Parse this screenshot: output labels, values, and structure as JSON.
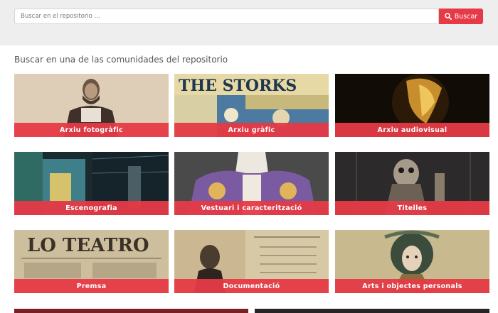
{
  "search": {
    "placeholder": "Buscar en el repositorio ...",
    "value": "",
    "button_label": "Buscar",
    "button_icon": "search-icon"
  },
  "section": {
    "heading": "Buscar en una de las comunidades del repositorio"
  },
  "communities": [
    {
      "label": "Arxiu fotogràfic",
      "image": "portrait-photograph"
    },
    {
      "label": "Arxiu gràfic",
      "image": "the-storks-poster"
    },
    {
      "label": "Arxiu audiovisual",
      "image": "golden-mask-in-dark"
    },
    {
      "label": "Escenografia",
      "image": "stage-set-model"
    },
    {
      "label": "Vestuari i caracterització",
      "image": "embroidered-costume"
    },
    {
      "label": "Titelles",
      "image": "puppet-figure"
    },
    {
      "label": "Premsa",
      "image": "lo-teatro-newspaper"
    },
    {
      "label": "Documentació",
      "image": "teatro-principal-program"
    },
    {
      "label": "Arts i objectes personals",
      "image": "art-nouveau-portrait"
    }
  ],
  "colors": {
    "accent": "#e63a46",
    "band": "#eeeeee",
    "heading_text": "#555555"
  }
}
